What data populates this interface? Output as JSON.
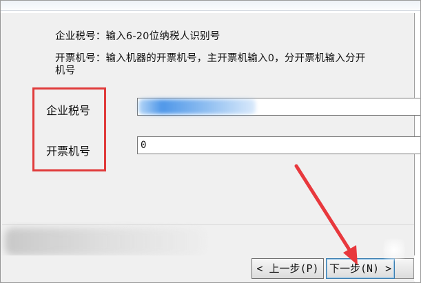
{
  "instructions": {
    "tax_hint": "企业税号：输入6-20位纳税人识别号",
    "machine_hint_line1": "开票机号：输入机器的开票机号，主开票机输入0，分开票机输入分开",
    "machine_hint_line2": "机号"
  },
  "form": {
    "tax_label": "企业税号",
    "tax_value": "",
    "machine_label": "开票机号",
    "machine_value": "0"
  },
  "buttons": {
    "prev_label": "< 上一步(P)",
    "next_label": "下一步(N) >"
  },
  "annotation": {
    "highlight_color": "#e03a3a",
    "arrow_color": "#e8383d"
  }
}
